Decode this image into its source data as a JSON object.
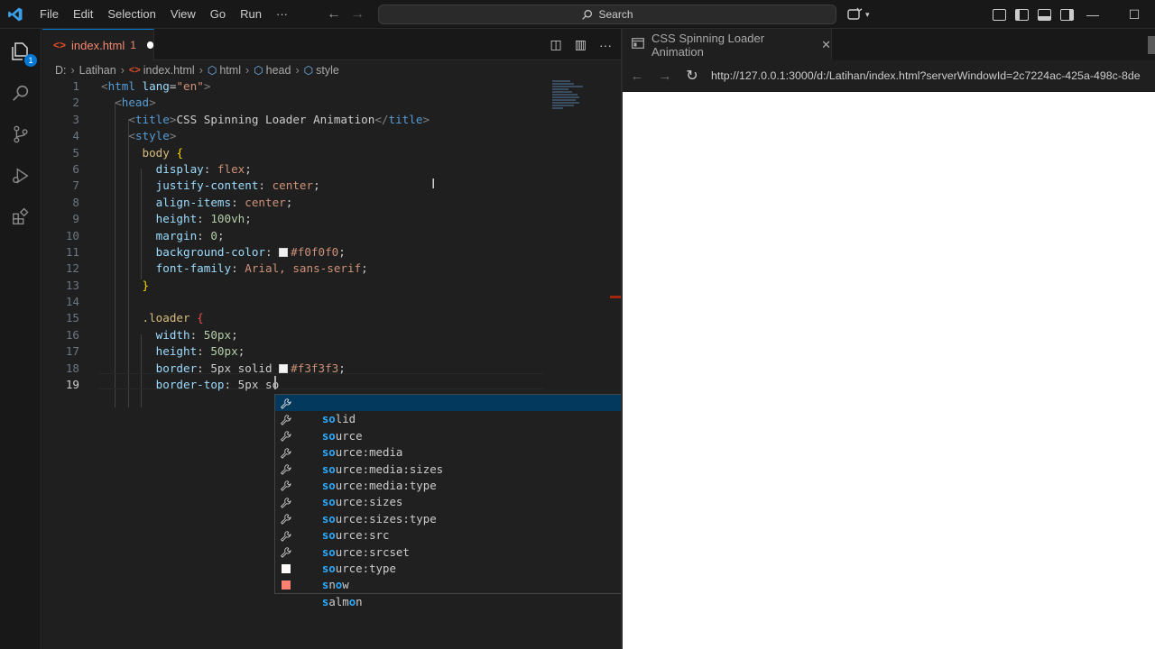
{
  "menu": [
    "File",
    "Edit",
    "Selection",
    "View",
    "Go",
    "Run",
    "···"
  ],
  "search_label": "Search",
  "explorer_badge": "1",
  "editor": {
    "tab": {
      "name": "index.html",
      "problems": "1"
    },
    "breadcrumb": [
      "D:",
      "Latihan",
      "index.html",
      "html",
      "head",
      "style"
    ],
    "line_numbers": [
      "1",
      "2",
      "3",
      "4",
      "5",
      "6",
      "7",
      "8",
      "9",
      "10",
      "11",
      "12",
      "13",
      "14",
      "15",
      "16",
      "17",
      "18",
      "19"
    ],
    "code": {
      "l1a": "<",
      "l1b": "html",
      "l1c": "lang",
      "l1d": "=",
      "l1e": "\"en\"",
      "l1f": ">",
      "l2a": "<",
      "l2b": "head",
      "l2c": ">",
      "l3a": "<",
      "l3b": "title",
      "l3c": ">",
      "l3d": "CSS Spinning Loader Animation",
      "l3e": "</",
      "l3f": "title",
      "l3g": ">",
      "l4a": "<",
      "l4b": "style",
      "l4c": ">",
      "l5a": "body",
      "l5b": "{",
      "l6a": "display",
      "l6b": ": ",
      "l6c": "flex",
      "l6d": ";",
      "l7a": "justify-content",
      "l7b": ": ",
      "l7c": "center",
      "l7d": ";",
      "l8a": "align-items",
      "l8b": ": ",
      "l8c": "center",
      "l8d": ";",
      "l9a": "height",
      "l9b": ": ",
      "l9c": "100vh",
      "l9d": ";",
      "l10a": "margin",
      "l10b": ": ",
      "l10c": "0",
      "l10d": ";",
      "l11a": "background-color",
      "l11b": ": ",
      "l11c": "#f0f0f0",
      "l11d": ";",
      "l12a": "font-family",
      "l12b": ": ",
      "l12c": "Arial, sans-serif",
      "l12d": ";",
      "l13a": "}",
      "l15a": ".loader",
      "l15b": "{",
      "l16a": "width",
      "l16b": ": ",
      "l16c": "50px",
      "l16d": ";",
      "l17a": "height",
      "l17b": ": ",
      "l17c": "50px",
      "l17d": ";",
      "l18a": "border",
      "l18b": ": ",
      "l18c": "5px solid ",
      "l18d": "#f3f3f3",
      "l18e": ";",
      "l19a": "border-top",
      "l19b": ": ",
      "l19c": "5px so"
    }
  },
  "suggestions": [
    {
      "match": "so",
      "rest": "lid",
      "kind": "property"
    },
    {
      "match": "so",
      "rest": "urce",
      "kind": "property"
    },
    {
      "match": "so",
      "rest": "urce:media",
      "kind": "property"
    },
    {
      "match": "so",
      "rest": "urce:media:sizes",
      "kind": "property"
    },
    {
      "match": "so",
      "rest": "urce:media:type",
      "kind": "property"
    },
    {
      "match": "so",
      "rest": "urce:sizes",
      "kind": "property"
    },
    {
      "match": "so",
      "rest": "urce:sizes:type",
      "kind": "property"
    },
    {
      "match": "so",
      "rest": "urce:src",
      "kind": "property"
    },
    {
      "match": "so",
      "rest": "urce:srcset",
      "kind": "property"
    },
    {
      "match": "so",
      "rest": "urce:type",
      "kind": "property"
    },
    {
      "match": "s",
      "mid": "n",
      "o": "o",
      "rest": "w",
      "kind": "color",
      "color": "#fffafa"
    },
    {
      "match": "s",
      "mid": "alm",
      "o": "o",
      "rest": "n",
      "kind": "color",
      "color": "#fa8072"
    }
  ],
  "browser": {
    "tab_title": "CSS Spinning Loader Animation",
    "url": "http://127.0.0.1:3000/d:/Latihan/index.html?serverWindowId=2c7224ac-425a-498c-8de"
  },
  "colors": {
    "accent": "#0078d4",
    "swatch1": "#f0f0f0",
    "swatch2": "#f3f3f3"
  }
}
